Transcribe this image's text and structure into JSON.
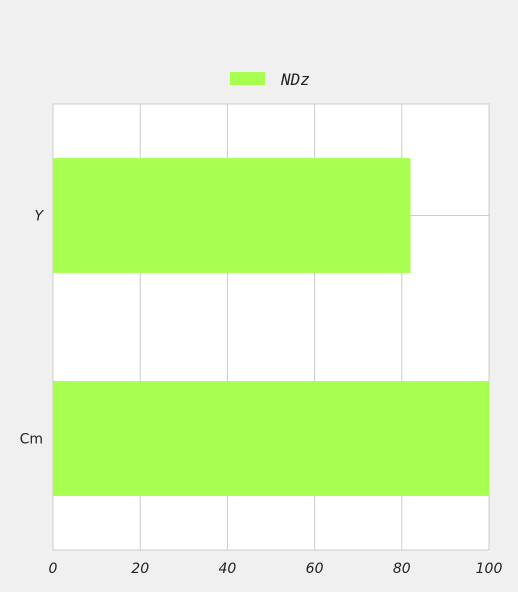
{
  "chart_data": {
    "type": "bar",
    "orientation": "horizontal",
    "categories": [
      "Y",
      "Cm"
    ],
    "series": [
      {
        "name": "NDz",
        "values": [
          82,
          100
        ],
        "color": "#a8ff4f"
      }
    ],
    "xlim": [
      0,
      100
    ],
    "xticks": [
      "0",
      "20",
      "40",
      "60",
      "80",
      "100"
    ],
    "category_label_styles": [
      "italic",
      "normal"
    ],
    "grid": true,
    "legend_placement": "top-center",
    "title": "",
    "xlabel": "",
    "ylabel": ""
  },
  "colors": {
    "background": "#f0f0f0",
    "plot_background": "#ffffff",
    "grid": "#cccccc",
    "bar": "#a8ff4f"
  }
}
